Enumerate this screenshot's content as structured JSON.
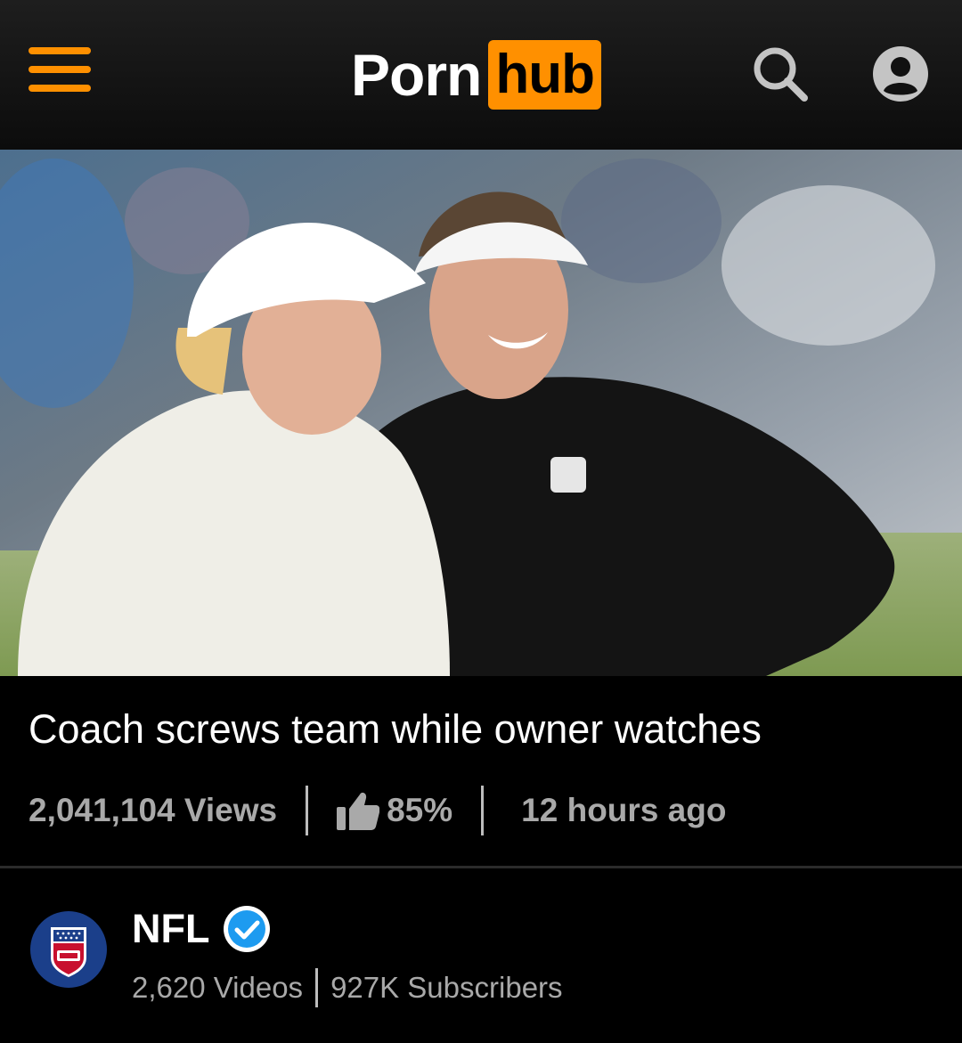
{
  "header": {
    "logo_left": "Porn",
    "logo_right": "hub",
    "accent_color": "#ff9000"
  },
  "video": {
    "title": "Coach screws team while owner watches",
    "views": "2,041,104 Views",
    "rating": "85%",
    "uploaded": "12 hours ago"
  },
  "channel": {
    "name": "NFL",
    "videos": "2,620 Videos",
    "subscribers": "927K Subscribers",
    "verified_color": "#1d9bf0"
  },
  "icons": {
    "menu": "hamburger-menu-icon",
    "search": "search-icon",
    "account": "account-icon",
    "like": "thumbs-up-icon",
    "verified": "verified-check-icon"
  }
}
